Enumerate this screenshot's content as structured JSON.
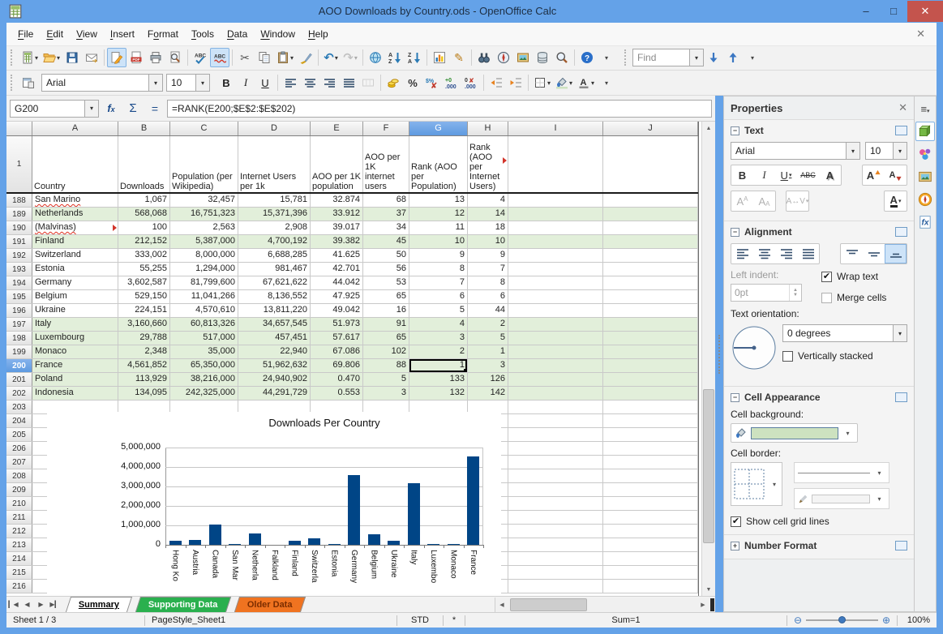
{
  "window": {
    "title": "AOO Downloads by Country.ods - OpenOffice Calc"
  },
  "menubar": {
    "items": [
      {
        "label": "File",
        "u": 0
      },
      {
        "label": "Edit",
        "u": 0
      },
      {
        "label": "View",
        "u": 0
      },
      {
        "label": "Insert",
        "u": 0
      },
      {
        "label": "Format",
        "u": 1
      },
      {
        "label": "Tools",
        "u": 0
      },
      {
        "label": "Data",
        "u": 0
      },
      {
        "label": "Window",
        "u": 0
      },
      {
        "label": "Help",
        "u": 0
      }
    ]
  },
  "standard_toolbar": [
    {
      "name": "new-document",
      "dropdown": true
    },
    {
      "name": "open-document",
      "dropdown": true
    },
    {
      "name": "save-document"
    },
    {
      "name": "email-document"
    },
    {
      "sep": true
    },
    {
      "name": "edit-file",
      "active": true
    },
    {
      "name": "export-pdf"
    },
    {
      "name": "print-file"
    },
    {
      "name": "page-preview"
    },
    {
      "sep": true
    },
    {
      "name": "spellcheck"
    },
    {
      "name": "auto-spellcheck",
      "active": true
    },
    {
      "sep": true
    },
    {
      "name": "cut"
    },
    {
      "name": "copy"
    },
    {
      "name": "paste",
      "dropdown": true
    },
    {
      "name": "format-paintbrush"
    },
    {
      "sep": true
    },
    {
      "name": "undo",
      "dropdown": true
    },
    {
      "name": "redo",
      "dropdown": true,
      "disabled": true
    },
    {
      "sep": true
    },
    {
      "name": "hyperlink"
    },
    {
      "name": "sort-ascending"
    },
    {
      "name": "sort-descending"
    },
    {
      "sep": true
    },
    {
      "name": "insert-chart"
    },
    {
      "name": "show-draw-functions"
    },
    {
      "sep": true
    },
    {
      "name": "find-and-replace"
    },
    {
      "name": "navigator"
    },
    {
      "name": "gallery"
    },
    {
      "name": "data-sources"
    },
    {
      "name": "zoom"
    },
    {
      "sep": true
    },
    {
      "name": "help"
    },
    {
      "name": "toolbar-more",
      "overflow": true
    }
  ],
  "find_toolbar": {
    "placeholder": "Find"
  },
  "formatting_toolbar": {
    "font_name": "Arial",
    "font_size": "10",
    "items_left": [
      {
        "name": "styles-window"
      }
    ],
    "items_right": [
      {
        "name": "bold"
      },
      {
        "name": "italic"
      },
      {
        "name": "underline"
      },
      {
        "sep": true
      },
      {
        "name": "align-left"
      },
      {
        "name": "align-center"
      },
      {
        "name": "align-right"
      },
      {
        "name": "align-justify"
      },
      {
        "name": "merge-cells",
        "disabled": true
      },
      {
        "sep": true
      },
      {
        "name": "currency-format"
      },
      {
        "name": "percent-format"
      },
      {
        "name": "standard-format"
      },
      {
        "name": "add-decimal"
      },
      {
        "name": "delete-decimal"
      },
      {
        "sep": true
      },
      {
        "name": "decrease-indent"
      },
      {
        "name": "increase-indent"
      },
      {
        "sep": true
      },
      {
        "name": "borders",
        "dropdown": true
      },
      {
        "name": "background-color",
        "dropdown": true
      },
      {
        "name": "font-color",
        "dropdown": true
      },
      {
        "name": "toolbar-more",
        "overflow": true
      }
    ]
  },
  "formula_bar": {
    "cell_reference": "G200",
    "formula": "=RANK(E200;$E$2:$E$202)"
  },
  "sheet": {
    "visible_columns": [
      "A",
      "B",
      "C",
      "D",
      "E",
      "F",
      "G",
      "H",
      "I",
      "J"
    ],
    "selected_column": "G",
    "selected_row": 200,
    "selected_cell": "G200",
    "header_row": {
      "number": 1,
      "cells": {
        "A": "Country",
        "B": "Downloads",
        "C": "Population (per Wikipedia)",
        "D": "Internet Users per 1k",
        "E": "AOO per 1K population",
        "F": "AOO per 1K internet users",
        "G": "Rank (AOO per Population)",
        "H": "Rank (AOO per Internet Users)"
      },
      "overflow_marker_column": "H"
    },
    "rows": [
      {
        "number": 188,
        "country": "San Marino",
        "values": [
          "1,067",
          "32,457",
          "15,781",
          "32.874",
          "68",
          "13",
          "4"
        ],
        "green": false,
        "misspelled": true
      },
      {
        "number": 189,
        "country": "Netherlands",
        "values": [
          "568,068",
          "16,751,323",
          "15,371,396",
          "33.912",
          "37",
          "12",
          "14"
        ],
        "green": true
      },
      {
        "number": 190,
        "country": "(Malvinas)",
        "values": [
          "100",
          "2,563",
          "2,908",
          "39.017",
          "34",
          "11",
          "18"
        ],
        "green": false,
        "misspelled": true,
        "overflow": true
      },
      {
        "number": 191,
        "country": "Finland",
        "values": [
          "212,152",
          "5,387,000",
          "4,700,192",
          "39.382",
          "45",
          "10",
          "10"
        ],
        "green": true
      },
      {
        "number": 192,
        "country": "Switzerland",
        "values": [
          "333,002",
          "8,000,000",
          "6,688,285",
          "41.625",
          "50",
          "9",
          "9"
        ],
        "green": false
      },
      {
        "number": 193,
        "country": "Estonia",
        "values": [
          "55,255",
          "1,294,000",
          "981,467",
          "42.701",
          "56",
          "8",
          "7"
        ],
        "green": false
      },
      {
        "number": 194,
        "country": "Germany",
        "values": [
          "3,602,587",
          "81,799,600",
          "67,621,622",
          "44.042",
          "53",
          "7",
          "8"
        ],
        "green": false
      },
      {
        "number": 195,
        "country": "Belgium",
        "values": [
          "529,150",
          "11,041,266",
          "8,136,552",
          "47.925",
          "65",
          "6",
          "6"
        ],
        "green": false
      },
      {
        "number": 196,
        "country": "Ukraine",
        "values": [
          "224,151",
          "4,570,610",
          "13,811,220",
          "49.042",
          "16",
          "5",
          "44"
        ],
        "green": false
      },
      {
        "number": 197,
        "country": "Italy",
        "values": [
          "3,160,660",
          "60,813,326",
          "34,657,545",
          "51.973",
          "91",
          "4",
          "2"
        ],
        "green": true
      },
      {
        "number": 198,
        "country": "Luxembourg",
        "values": [
          "29,788",
          "517,000",
          "457,451",
          "57.617",
          "65",
          "3",
          "5"
        ],
        "green": true
      },
      {
        "number": 199,
        "country": "Monaco",
        "values": [
          "2,348",
          "35,000",
          "22,940",
          "67.086",
          "102",
          "2",
          "1"
        ],
        "green": true
      },
      {
        "number": 200,
        "country": "France",
        "values": [
          "4,561,852",
          "65,350,000",
          "51,962,632",
          "69.806",
          "88",
          "1",
          "3"
        ],
        "green": true
      },
      {
        "number": 201,
        "country": "Poland",
        "values": [
          "113,929",
          "38,216,000",
          "24,940,902",
          "0.470",
          "5",
          "133",
          "126"
        ],
        "green": true
      },
      {
        "number": 202,
        "country": "Indonesia",
        "values": [
          "134,095",
          "242,325,000",
          "44,291,729",
          "0.553",
          "3",
          "132",
          "142"
        ],
        "green": true
      }
    ],
    "empty_rows_from": 203,
    "empty_rows_to": 216
  },
  "chart_data": {
    "type": "bar",
    "title": "Downloads Per Country",
    "categories": [
      "Hong Kong",
      "Austria",
      "Canada",
      "San Marino",
      "Netherlands",
      "Falkland Islands (Malvinas)",
      "Finland",
      "Switzerland",
      "Estonia",
      "Germany",
      "Belgium",
      "Ukraine",
      "Italy",
      "Luxembourg",
      "Monaco",
      "France"
    ],
    "values": [
      200000,
      260000,
      1050000,
      1067,
      568068,
      100,
      212152,
      333002,
      55255,
      3602587,
      529150,
      224151,
      3160660,
      29788,
      2348,
      4561852
    ],
    "xlabels_display": [
      "Hong Ko",
      "Austria",
      "Canada",
      "San Mar",
      "Netherla",
      "Falkland",
      "Finland",
      "Switzerla",
      "Estonia",
      "Germany",
      "Belgium",
      "Ukraine",
      "Italy",
      "Luxembo",
      "Monaco",
      "France"
    ],
    "ylabel": "",
    "xlabel": "",
    "ylim": [
      0,
      5000000
    ],
    "yticks": [
      "5,000,000",
      "4,000,000",
      "3,000,000",
      "2,000,000",
      "1,000,000",
      "0"
    ],
    "grid": true,
    "legend": "none",
    "bar_color": "#004586"
  },
  "sheet_tabs": {
    "tabs": [
      {
        "label": "Summary",
        "active": true
      },
      {
        "label": "Supporting Data",
        "color": "#2ab04e",
        "text_color": "#ffffff"
      },
      {
        "label": "Older Data",
        "color": "#f07320",
        "text_color": "#7b2d00"
      }
    ]
  },
  "statusbar": {
    "sheet_position": "Sheet 1 / 3",
    "page_style": "PageStyle_Sheet1",
    "insert_mode": "STD",
    "modified_flag": "*",
    "selection_summary": "Sum=1",
    "zoom_level": "100%"
  },
  "sidebar": {
    "title": "Properties",
    "text_section": {
      "title": "Text",
      "font_name": "Arial",
      "font_size": "10"
    },
    "alignment_section": {
      "title": "Alignment",
      "left_indent_label": "Left indent:",
      "left_indent_value": "0pt",
      "wrap_text_label": "Wrap text",
      "wrap_text_checked": true,
      "merge_cells_label": "Merge cells",
      "merge_cells_checked": false,
      "orientation_label": "Text orientation:",
      "orientation_value": "0 degrees",
      "vertically_stacked_label": "Vertically stacked",
      "vertically_stacked_checked": false
    },
    "cell_appearance_section": {
      "title": "Cell Appearance",
      "background_label": "Cell background:",
      "background_color": "#cde2c0",
      "border_label": "Cell border:",
      "gridlines_label": "Show cell grid lines",
      "gridlines_checked": true
    },
    "number_format_section": {
      "title": "Number Format"
    }
  }
}
